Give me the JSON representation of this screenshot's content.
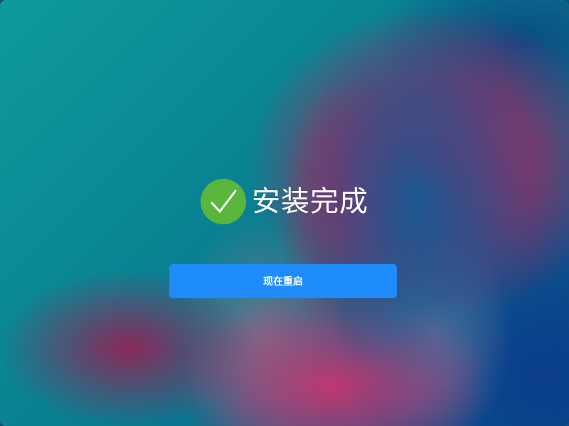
{
  "result": {
    "title": "安装完成",
    "icon": "check-circle-icon",
    "icon_color": "#5ab53c"
  },
  "actions": {
    "restart_label": "现在重启",
    "restart_color": "#1e8cfa"
  }
}
